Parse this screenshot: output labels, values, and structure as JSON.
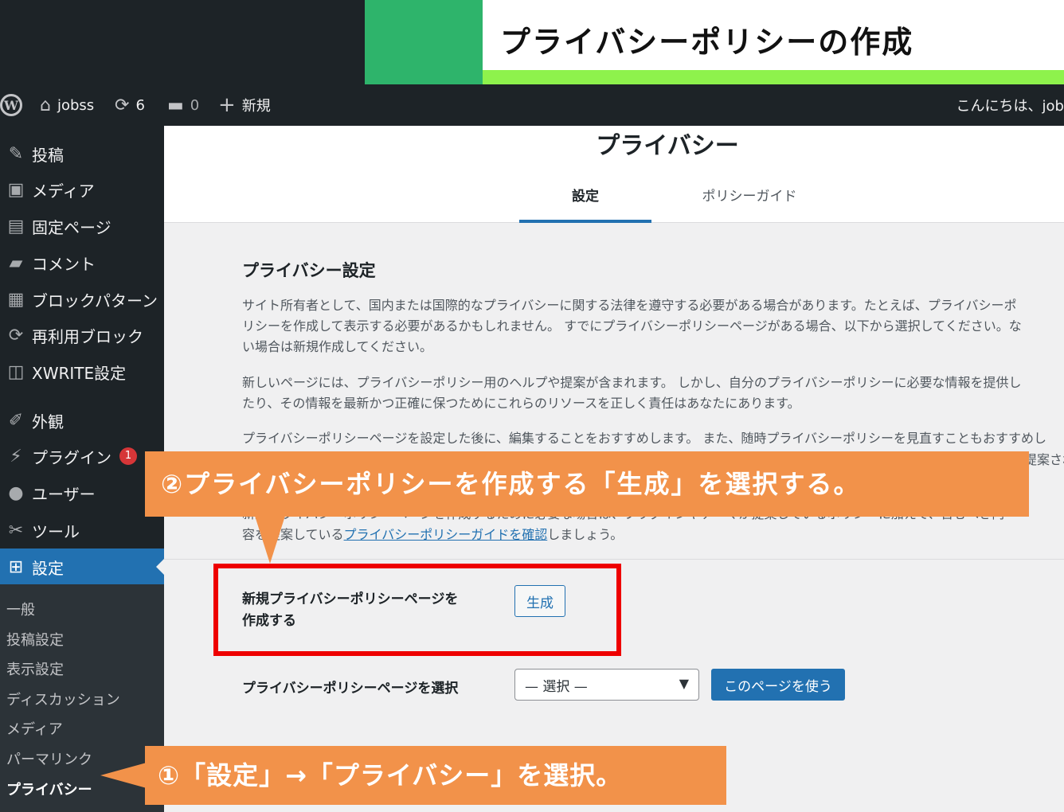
{
  "banner": {
    "title": "プライバシーポリシーの作成"
  },
  "adminbar": {
    "site_name": "jobss",
    "updates_count": "6",
    "comments_count": "0",
    "new_label": "新規",
    "greeting": "こんにちは、job"
  },
  "sidebar": {
    "items": [
      {
        "label": "投稿",
        "icon": "pin-icon"
      },
      {
        "label": "メディア",
        "icon": "media-icon"
      },
      {
        "label": "固定ページ",
        "icon": "page-icon"
      },
      {
        "label": "コメント",
        "icon": "comment-icon"
      },
      {
        "label": "ブロックパターン",
        "icon": "grid-icon"
      },
      {
        "label": "再利用ブロック",
        "icon": "reuse-icon"
      },
      {
        "label": "XWRITE設定",
        "icon": "book-icon"
      },
      {
        "label": "外観",
        "icon": "brush-icon"
      },
      {
        "label": "プラグイン",
        "icon": "plugin-icon",
        "badge": "1"
      },
      {
        "label": "ユーザー",
        "icon": "user-icon"
      },
      {
        "label": "ツール",
        "icon": "wrench-icon"
      },
      {
        "label": "設定",
        "icon": "settings-icon",
        "active": true
      }
    ],
    "submenu": [
      "一般",
      "投稿設定",
      "表示設定",
      "ディスカッション",
      "メディア",
      "パーマリンク",
      "プライバシー"
    ]
  },
  "main": {
    "page_title": "プライバシー",
    "tabs": [
      "設定",
      "ポリシーガイド"
    ],
    "settings_title": "プライバシー設定",
    "para1": [
      "サイト所有者として、国内または国際的なプライバシーに関する法律を遵守する必要がある場合があります。たとえば、プライバシーポ",
      "リシーを作成して表示する必要があるかもしれません。 すでにプライバシーポリシーページがある場合、以下から選択してください。な",
      "い場合は新規作成してください。"
    ],
    "para2": [
      "新しいページには、プライバシーポリシー用のヘルプや提案が含まれます。 しかし、自分のプライバシーポリシーに必要な情報を提供し",
      "たり、その情報を最新かつ正確に保つためにこれらのリソースを正しく責任はあなたにあります。"
    ],
    "para3": "プライバシーポリシーページを設定した後に、編集することをおすすめします。 また、随時プライバシーポリシーを見直すこともおすすめし",
    "para3_tail": "提案され",
    "para4_prefix": "新規プライバシーポリシーページを作成するために必要な場合は、プラグインやテーマが提案しているポリシーに加えて、含むべき内",
    "para4_line2_start": "容を",
    "para4_line2_mid": "提案している",
    "para4_link": "プライバシーポリシーガイドを確認",
    "para4_suffix": "しましょう。",
    "create_label_line1": "新規プライバシーポリシーページを",
    "create_label_line2": "作成する",
    "generate_button": "生成",
    "select_label": "プライバシーポリシーページを選択",
    "select_value": "— 選択 —",
    "use_page_button": "このページを使う"
  },
  "annotations": {
    "callout_1": "①「設定」→「プライバシー」を選択。",
    "callout_2": "②プライバシーポリシーを作成する「生成」を選択する。"
  },
  "colors": {
    "accent": "#2271b1",
    "admin_bg": "#1d2327",
    "callout": "#f2924a",
    "highlight": "#ee0000",
    "banner_green": "#2eb46b",
    "banner_lime": "#8ef24c"
  }
}
